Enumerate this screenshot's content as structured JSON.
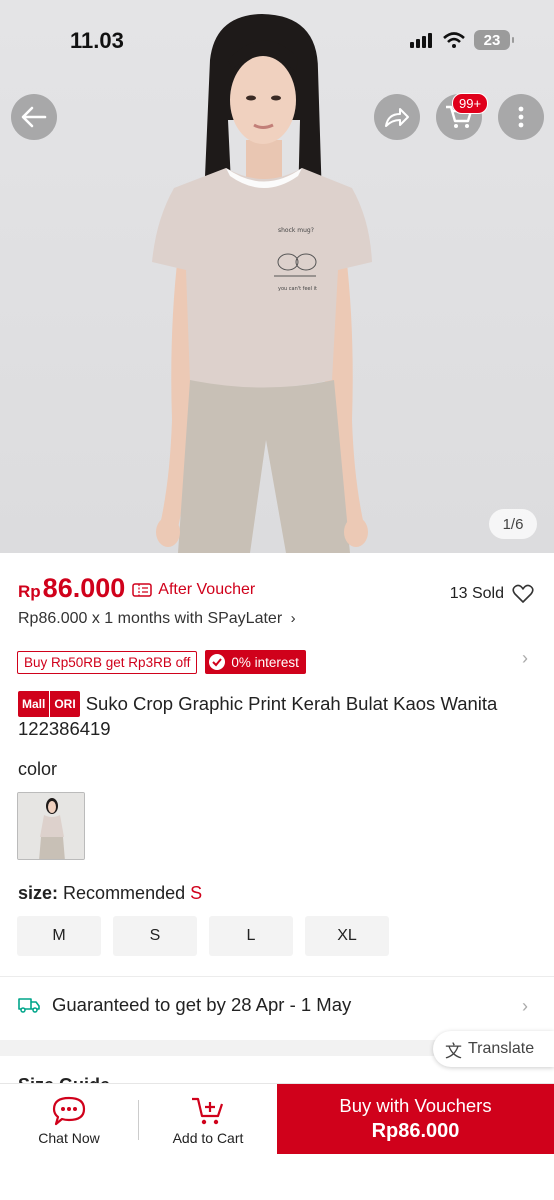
{
  "status_bar": {
    "time": "11.03",
    "battery": "23"
  },
  "header": {
    "cart_badge": "99+"
  },
  "gallery": {
    "counter": "1/6"
  },
  "pricing": {
    "currency": "Rp",
    "price": "86.000",
    "after_voucher": "After Voucher",
    "sold": "13 Sold",
    "installment": "Rp86.000 x 1 months with SPayLater",
    "promo": "Buy Rp50RB get Rp3RB off",
    "interest": "0% interest"
  },
  "product": {
    "badge_mall": "Mall",
    "badge_ori": "ORI",
    "title": "Suko Crop Graphic Print Kerah Bulat Kaos Wanita 122386419"
  },
  "variants": {
    "color_label": "color",
    "size_label": "size:",
    "size_recommended": "Recommended",
    "recommended_size": "S",
    "sizes": [
      "M",
      "S",
      "L",
      "XL"
    ]
  },
  "shipping": {
    "text": "Guaranteed to get by 28 Apr - 1 May"
  },
  "translate_label": "Translate",
  "size_guide": "Size Guide",
  "bottom_bar": {
    "chat": "Chat Now",
    "cart": "Add to Cart",
    "buy_line1": "Buy with Vouchers",
    "buy_line2": "Rp86.000"
  },
  "colors": {
    "accent": "#d0011b",
    "ship_icon": "#00a58a"
  }
}
